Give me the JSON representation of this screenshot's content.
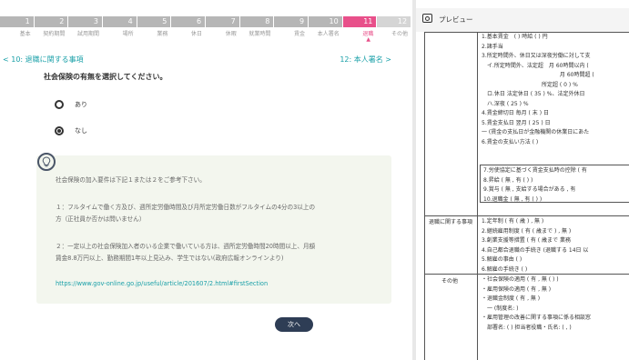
{
  "steps": {
    "numbers": [
      "1",
      "2",
      "3",
      "4",
      "5",
      "6",
      "7",
      "8",
      "9",
      "10",
      "11",
      "12"
    ],
    "labels": [
      "基本",
      "契約期間",
      "試用期間",
      "場所",
      "業務",
      "休日",
      "休暇",
      "就業時間",
      "賃金",
      "本人署名",
      "退職",
      "その他"
    ],
    "active_index": 10,
    "colors": {
      "done": "#b6b6b6",
      "active": "#e8508a",
      "todo": "#d5d5d5"
    }
  },
  "nav": {
    "prev": "< 10: 退職に関する事項",
    "next": "12: 本人署名 >"
  },
  "question": "社会保険の有無を選択してください。",
  "options": [
    {
      "label": "あり",
      "checked": false
    },
    {
      "label": "なし",
      "checked": true
    }
  ],
  "hint": {
    "icon": "lightbulb-icon",
    "p1": "社会保険の加入要件は下記１または２をご参考下さい。",
    "p2a": "１：フルタイムで働く方及び、週所定労働時間及び月所定労働日数がフルタイムの4分の3以上の",
    "p2b": "方（正社員か否かは問いません）",
    "p3a": "２：一定以上の社会保険加入者のいる企業で働いている方は、週所定労働時間20時間以上、月額",
    "p3b": "賃金8.8万円以上、勤務期間1年以上見込み、学生ではない(政府広報オンラインより)",
    "link": "https://www.gov-online.go.jp/useful/article/201607/2.html#firstSection"
  },
  "next_button": "次へ",
  "preview": {
    "title": "プレビュー",
    "top_lines": [
      "1.基本賃金　( ) 時給 ( ) 円",
      "2.諸手当",
      "3.所定時間外、休日又は深夜労働に対して支",
      "　イ.所定時間外、法定超　月 60時間以内 (",
      "　　　　　　　　　　　　　　 月 60時間超 (",
      "　　　　　　　　　　　所定超 ( 0 ) %",
      "　ロ.休日  法定休日 ( 35 ) %、法定外休日",
      "　ハ.深夜 ( 25 ) %",
      "4.賃金締切日  毎月 ( 末 ) 日",
      "5.賃金支払日  翌月 ( 25 ) 日",
      "一 (賃金の支払日が金融機関の休業日にあた",
      "6.賃金の支払い方法 ( )"
    ],
    "box_lines": [
      "7.労使協定に基づく賃金支払時の控除 ( 有",
      "8.昇給 ( 無 , 有 ( ) )",
      "9.賞与 ( 無 , 支給する場合がある , 有",
      "10.退職金 ( 無 , 有 ( ) )"
    ],
    "retire_label": "退職に関する事項",
    "retire_lines": [
      "1.定年制 ( 有 ( 歳 ) , 無 )",
      "2.継続雇用制度 ( 有 ( 歳まで ) , 無 )",
      "3.創業支援等措置 ( 有 ( 歳まで 業務",
      "4.自己都合退職の手続き (退職する 14日 以",
      "5.解雇の事由 ( )",
      "6.解雇の手続き ( )"
    ],
    "other_label": "その他",
    "other_lines": [
      "・社会保険の適用 ( 有 , 無 ( ) )",
      "・雇用保険の適用 ( 有 , 無 )",
      "・退職金制度 ( 有 , 無 )",
      "　一 (制度名: )",
      "・雇用管理の改善に関する事項に係る相談窓",
      "　部署名: ( ) 担当者役職・氏名: ( , )"
    ]
  }
}
